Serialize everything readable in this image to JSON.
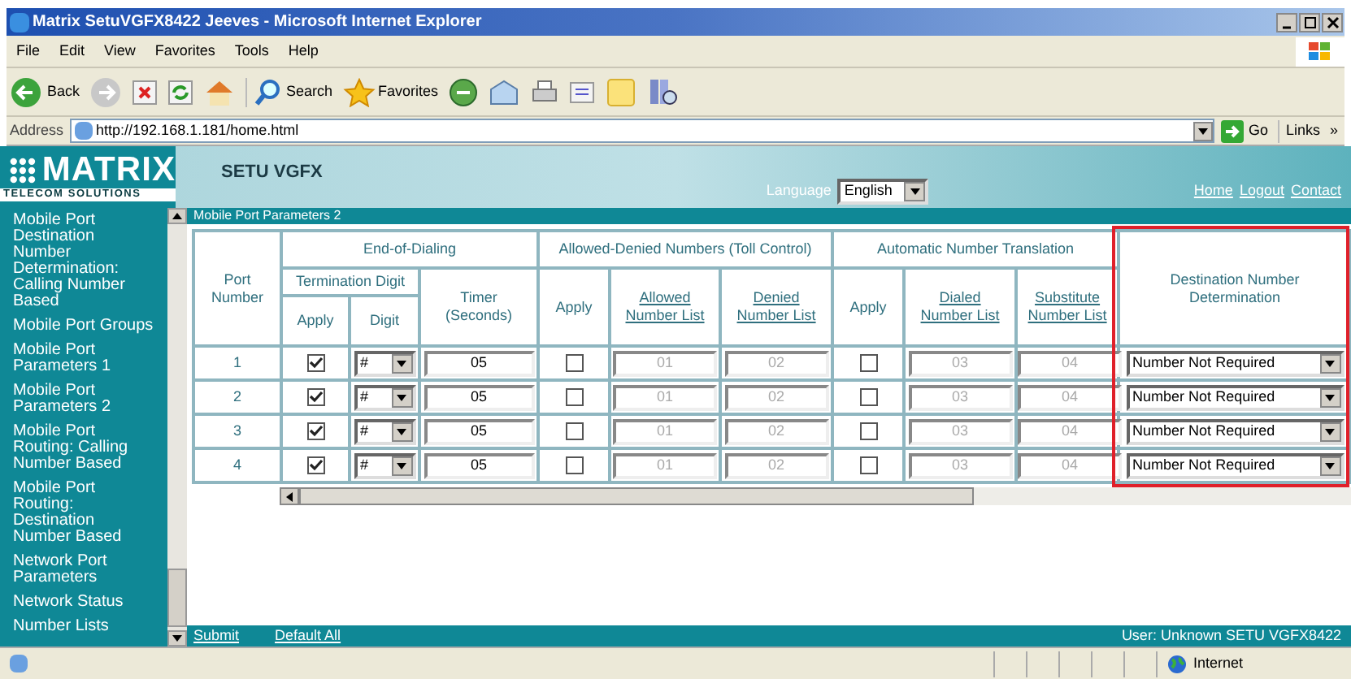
{
  "window": {
    "title": "Matrix SetuVGFX8422 Jeeves - Microsoft Internet Explorer"
  },
  "menu": [
    "File",
    "Edit",
    "View",
    "Favorites",
    "Tools",
    "Help"
  ],
  "toolbar": {
    "back": "Back",
    "search": "Search",
    "favorites": "Favorites"
  },
  "address": {
    "label": "Address",
    "url": "http://192.168.1.181/home.html",
    "go": "Go",
    "links": "Links",
    "more": "»"
  },
  "header": {
    "logo": "MATRIX",
    "tagline": "TELECOM SOLUTIONS",
    "product": "SETU VGFX",
    "language_label": "Language",
    "language": "English",
    "links": [
      "Home",
      "Logout",
      "Contact"
    ]
  },
  "sidebar": {
    "items": [
      "Mobile Port Destination Number Determination: Calling Number Based",
      "Mobile Port Groups",
      "Mobile Port Parameters 1",
      "Mobile Port Parameters 2",
      "Mobile Port Routing: Calling Number Based",
      "Mobile Port Routing: Destination Number Based",
      "Network Port Parameters",
      "Network Status",
      "Number Lists"
    ]
  },
  "page_title": "Mobile Port Parameters 2",
  "table": {
    "headers": {
      "port": "Port Number",
      "end_of_dialing": "End-of-Dialing",
      "termination_digit": "Termination Digit",
      "term_apply": "Apply",
      "digit": "Digit",
      "timer": "Timer (Seconds)",
      "toll": "Allowed-Denied Numbers (Toll Control)",
      "toll_apply": "Apply",
      "allowed": "Allowed Number List",
      "denied": "Denied Number List",
      "translation": "Automatic Number Translation",
      "trans_apply": "Apply",
      "dialed": "Dialed Number List",
      "substitute": "Substitute Number List"
    },
    "destination_header": {
      "label": "Destination Number Determination",
      "highlighted": true
    },
    "rows": [
      {
        "port": "1",
        "term_apply": true,
        "digit": "#",
        "timer": "05",
        "toll_apply": false,
        "allowed": "01",
        "denied": "02",
        "trans_apply": false,
        "dialed": "03",
        "substitute": "04",
        "destination": "Number Not Required"
      },
      {
        "port": "2",
        "term_apply": true,
        "digit": "#",
        "timer": "05",
        "toll_apply": false,
        "allowed": "01",
        "denied": "02",
        "trans_apply": false,
        "dialed": "03",
        "substitute": "04",
        "destination": "Number Not Required"
      },
      {
        "port": "3",
        "term_apply": true,
        "digit": "#",
        "timer": "05",
        "toll_apply": false,
        "allowed": "01",
        "denied": "02",
        "trans_apply": false,
        "dialed": "03",
        "substitute": "04",
        "destination": "Number Not Required"
      },
      {
        "port": "4",
        "term_apply": true,
        "digit": "#",
        "timer": "05",
        "toll_apply": false,
        "allowed": "01",
        "denied": "02",
        "trans_apply": false,
        "dialed": "03",
        "substitute": "04",
        "destination": "Number Not Required"
      }
    ]
  },
  "footer": {
    "actions": [
      "Submit",
      "Default All"
    ],
    "user": "User: Unknown SETU VGFX8422"
  },
  "status_bar": {
    "zone": "Internet"
  }
}
